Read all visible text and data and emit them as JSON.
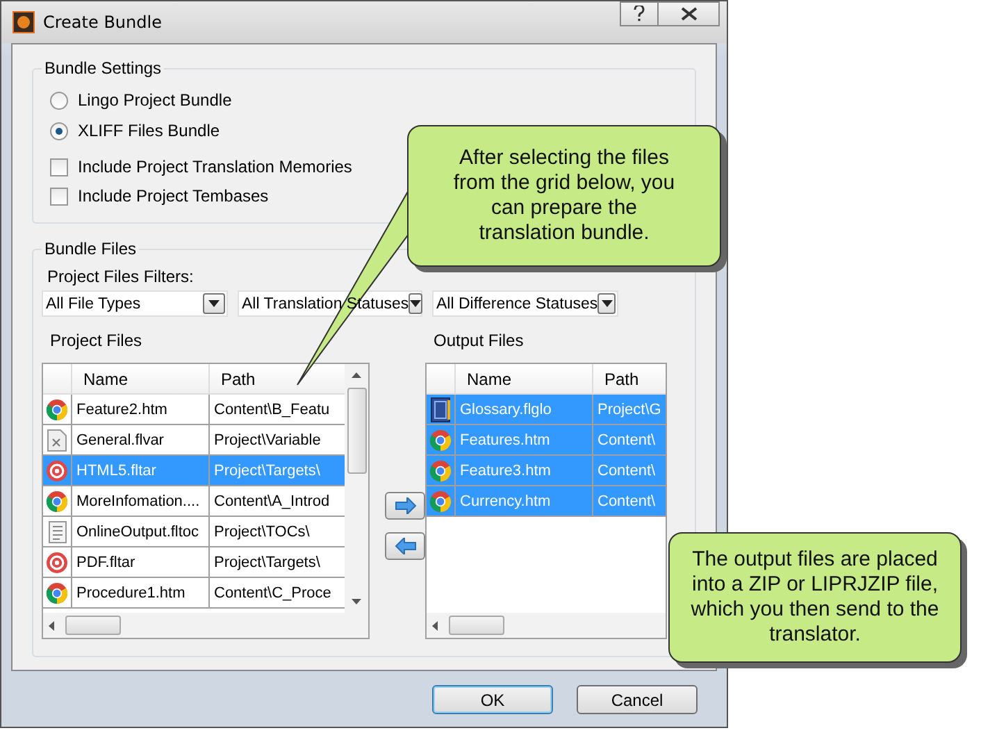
{
  "window": {
    "title": "Create Bundle"
  },
  "bundle_settings": {
    "title": "Bundle Settings",
    "options": [
      {
        "label": "Lingo Project Bundle",
        "selected": false
      },
      {
        "label": "XLIFF Files Bundle",
        "selected": true
      }
    ],
    "checkboxes": [
      {
        "label": "Include Project Translation Memories",
        "checked": false
      },
      {
        "label": "Include Project Tembases",
        "checked": false
      }
    ]
  },
  "bundle_files": {
    "title": "Bundle Files",
    "filters_label": "Project Files Filters:",
    "filters": [
      "All File Types",
      "All Translation Statuses",
      "All Difference Statuses"
    ],
    "project_files": {
      "title": "Project Files",
      "columns": [
        "Name",
        "Path"
      ],
      "rows": [
        {
          "kind": "chrome",
          "name": "Feature2.htm",
          "path": "Content\\B_Featu",
          "selected": false
        },
        {
          "kind": "variable",
          "name": "General.flvar",
          "path": "Project\\Variable",
          "selected": false
        },
        {
          "kind": "target",
          "name": "HTML5.fltar",
          "path": "Project\\Targets\\",
          "selected": true
        },
        {
          "kind": "chrome",
          "name": "MoreInfomation....",
          "path": "Content\\A_Introd",
          "selected": false
        },
        {
          "kind": "toc",
          "name": "OnlineOutput.fltoc",
          "path": "Project\\TOCs\\",
          "selected": false
        },
        {
          "kind": "target",
          "name": "PDF.fltar",
          "path": "Project\\Targets\\",
          "selected": false
        },
        {
          "kind": "chrome",
          "name": "Procedure1.htm",
          "path": "Content\\C_Proce",
          "selected": false
        }
      ]
    },
    "output_files": {
      "title": "Output Files",
      "columns": [
        "Name",
        "Path"
      ],
      "rows": [
        {
          "kind": "glossary",
          "name": "Glossary.flglo",
          "path": "Project\\G",
          "selected": true
        },
        {
          "kind": "chrome",
          "name": "Features.htm",
          "path": "Content\\",
          "selected": true
        },
        {
          "kind": "chrome",
          "name": "Feature3.htm",
          "path": "Content\\",
          "selected": true
        },
        {
          "kind": "chrome",
          "name": "Currency.htm",
          "path": "Content\\",
          "selected": true
        }
      ]
    }
  },
  "buttons": [
    {
      "label": "OK",
      "default": true
    },
    {
      "label": "Cancel",
      "default": false
    }
  ],
  "callouts": [
    "After selecting the files from the grid below, you can prepare the translation bundle.",
    "The output files are placed into a ZIP or LIPRJZIP file, which you then send to the translator."
  ]
}
